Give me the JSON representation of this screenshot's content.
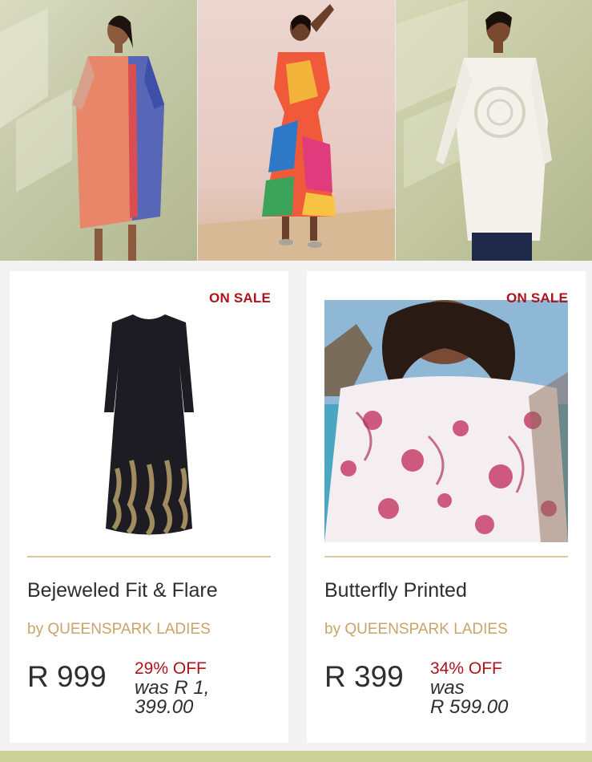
{
  "hero": {
    "tiles": [
      {
        "name": "printed-shirt-dress-model"
      },
      {
        "name": "colorful-tiered-dress-model"
      },
      {
        "name": "white-crochet-top-model"
      }
    ]
  },
  "products": [
    {
      "badge": "ON SALE",
      "title": "Bejeweled Fit & Flare",
      "brand": "by QUEENSPARK LADIES",
      "price": "R 999",
      "discount": "29% OFF",
      "was_line1": "was R 1,",
      "was_line2": "399.00"
    },
    {
      "badge": "ON SALE",
      "title": "Butterfly Printed",
      "brand": "by QUEENSPARK LADIES",
      "price": "R 399",
      "discount": "34% OFF",
      "was_line1": "was",
      "was_line2": "R 599.00"
    }
  ],
  "colors": {
    "sale": "#b0121b",
    "brand": "#c9a46a",
    "divider": "#d9c9a0",
    "footer": "#ccd19a"
  }
}
